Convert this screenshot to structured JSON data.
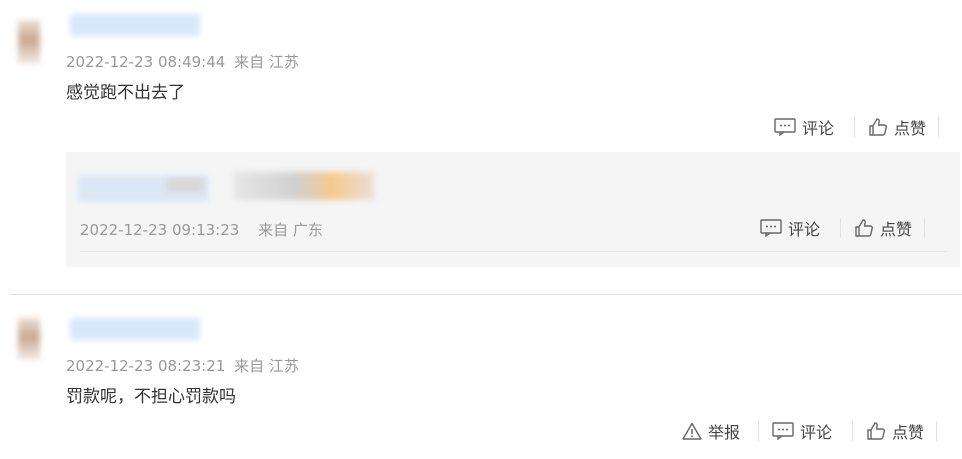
{
  "comments": [
    {
      "timestamp": "2022-12-23 08:49:44",
      "location": "来自 江苏",
      "text": "感觉跑不出去了",
      "actions": {
        "comment": "评论",
        "like": "点赞"
      },
      "reply": {
        "timestamp": "2022-12-23 09:13:23",
        "location": "来自 广东",
        "actions": {
          "comment": "评论",
          "like": "点赞"
        }
      }
    },
    {
      "timestamp": "2022-12-23 08:23:21",
      "location": "来自 江苏",
      "text": "罚款呢，不担心罚款吗",
      "actions": {
        "report": "举报",
        "comment": "评论",
        "like": "点赞"
      }
    }
  ]
}
